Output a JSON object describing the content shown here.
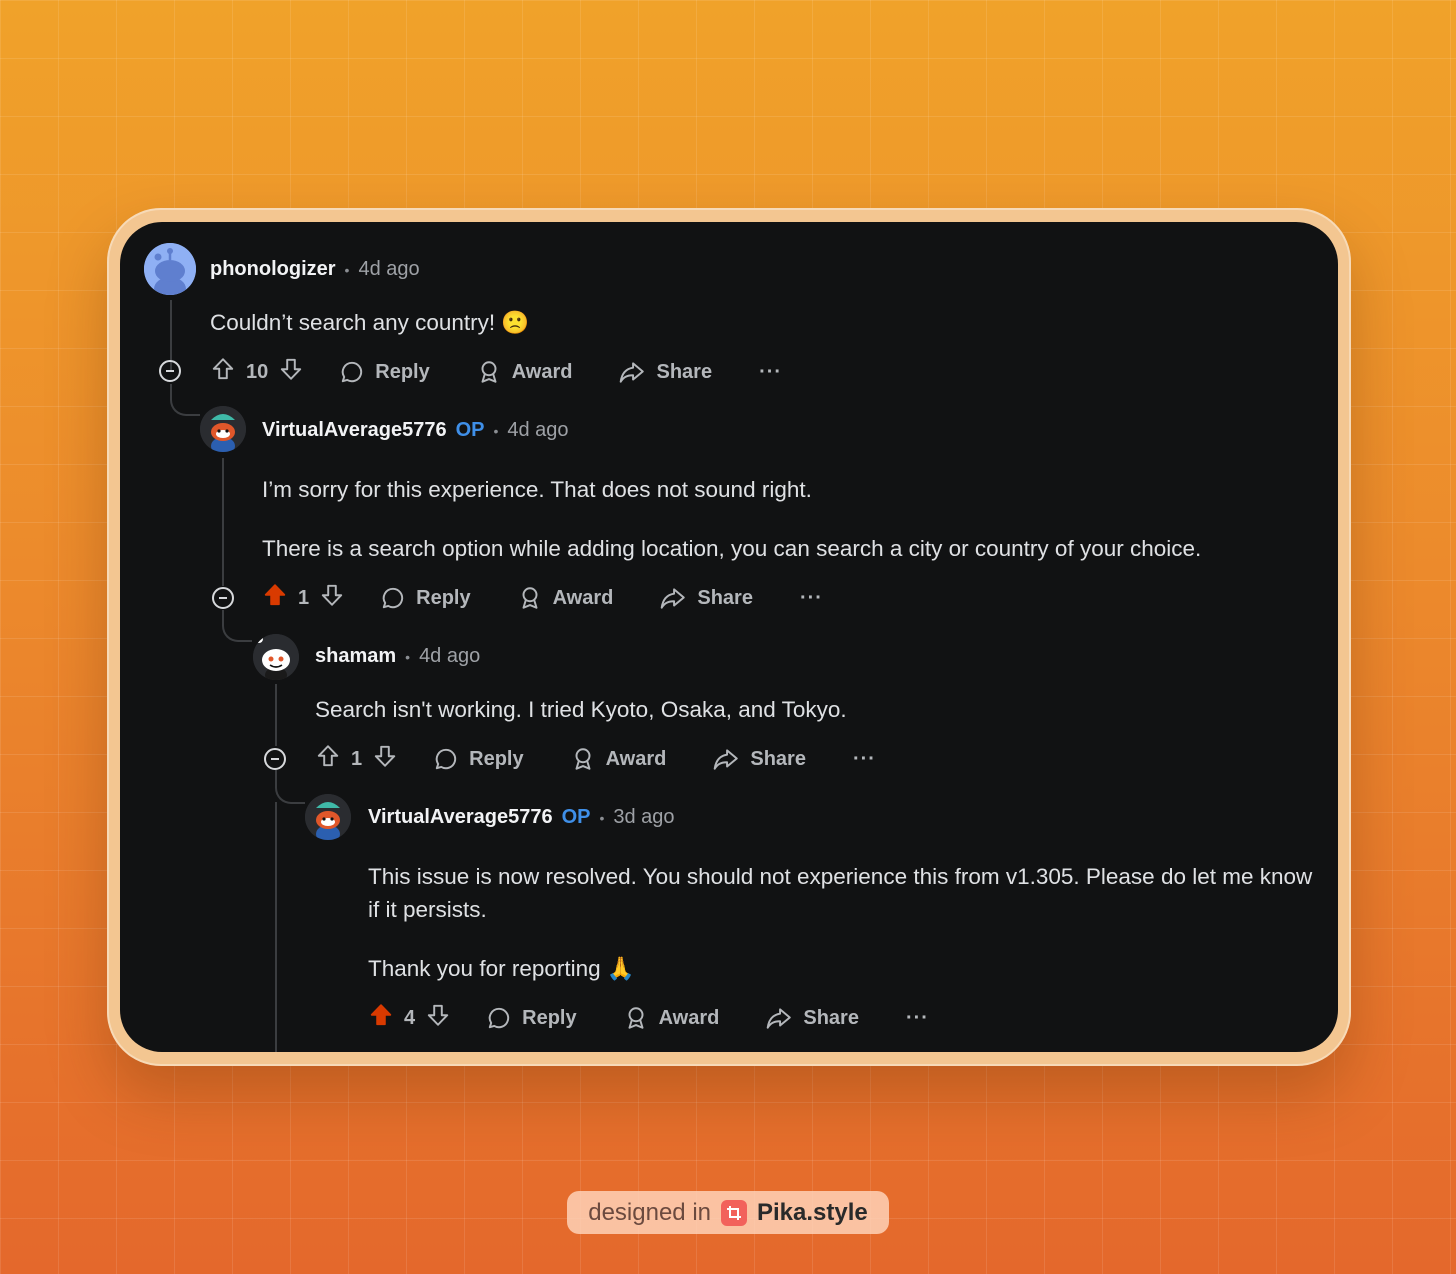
{
  "comments": [
    {
      "username": "phonologizer",
      "is_op": false,
      "timestamp": "4d ago",
      "paragraphs": [
        "Couldn’t search any country! 🙁"
      ],
      "votes": "10",
      "upvoted": false
    },
    {
      "username": "VirtualAverage5776",
      "is_op": true,
      "op_label": "OP",
      "timestamp": "4d ago",
      "paragraphs": [
        "I’m sorry for this experience. That does not sound right.",
        "There is a search option while adding location, you can search a city or country of your choice."
      ],
      "votes": "1",
      "upvoted": true
    },
    {
      "username": "shamam",
      "is_op": false,
      "timestamp": "4d ago",
      "paragraphs": [
        "Search isn't working. I tried Kyoto, Osaka, and Tokyo."
      ],
      "votes": "1",
      "upvoted": false
    },
    {
      "username": "VirtualAverage5776",
      "is_op": true,
      "op_label": "OP",
      "timestamp": "3d ago",
      "paragraphs": [
        "This issue is now resolved. You should not experience this from v1.305. Please do let me know if it persists.",
        "Thank you for reporting 🙏"
      ],
      "votes": "4",
      "upvoted": true
    }
  ],
  "actions": {
    "reply": "Reply",
    "award": "Award",
    "share": "Share",
    "more": "···"
  },
  "colors": {
    "upvote_active": "#d93a00",
    "op_blue": "#3f8fe8",
    "card_bg": "#111213"
  },
  "footer": {
    "prefix": "designed in",
    "brand": "Pika.style"
  }
}
